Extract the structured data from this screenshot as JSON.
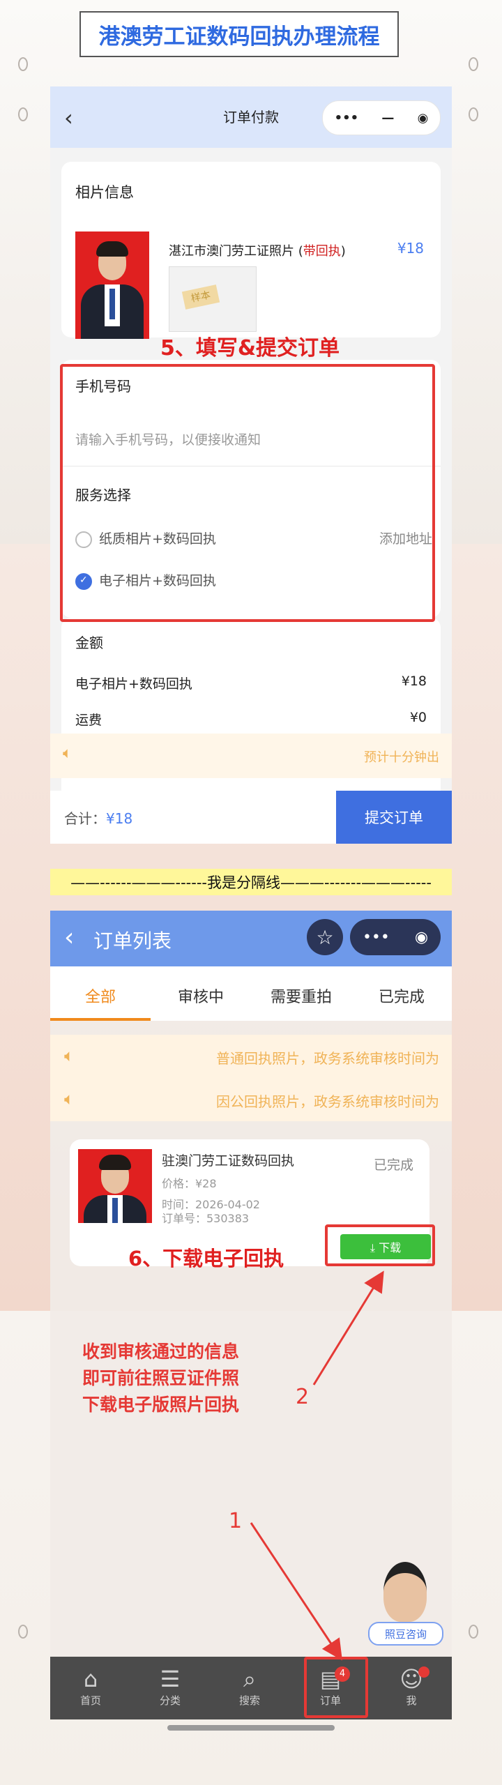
{
  "header": {
    "title": "港澳劳工证数码回执办理流程"
  },
  "screen1": {
    "nav": {
      "back_icon": "‹",
      "title": "订单付款",
      "more": "•••",
      "minimize": "—",
      "close": "◉"
    },
    "photo_section": {
      "heading": "相片信息",
      "product_name": "湛江市澳门劳工证照片 (",
      "product_tag": "带回执",
      "product_close": ")",
      "price": "¥18",
      "sample_stamp": "样本"
    },
    "step5": "5、填写&提交订单",
    "form": {
      "phone_label": "手机号码",
      "phone_placeholder": "请输入手机号码，以便接收通知",
      "service_label": "服务选择",
      "options": [
        {
          "label": "纸质相片+数码回执",
          "selected": false,
          "extra": "添加地址"
        },
        {
          "label": "电子相片+数码回执",
          "selected": true,
          "extra": ""
        }
      ]
    },
    "amount": {
      "heading": "金额",
      "rows": [
        {
          "label": "电子相片+数码回执",
          "value": "¥18"
        },
        {
          "label": "运费",
          "value": "¥0"
        }
      ]
    },
    "notice": {
      "icon": "speaker-icon",
      "text": "预计十分钟出"
    },
    "footer": {
      "total_label": "合计：",
      "total_amount": "¥18",
      "submit": "提交订单"
    }
  },
  "separator": "——------———------我是分隔线———-------———-----",
  "screen2": {
    "nav": {
      "back_icon": "‹",
      "title": "订单列表",
      "star": "☆",
      "more": "•••",
      "close": "◉"
    },
    "tabs": [
      "全部",
      "审核中",
      "需要重拍",
      "已完成"
    ],
    "active_tab": 0,
    "notices": [
      "普通回执照片，政务系统审核时间为",
      "因公回执照片，政务系统审核时间为"
    ],
    "order": {
      "name": "驻澳门劳工证数码回执",
      "status": "已完成",
      "price": "价格：¥28",
      "time": "时间：2026-04-02",
      "order_no": "订单号：530383",
      "download": "⤓ 下载"
    },
    "step6": "6、下载电子回执",
    "annotation": [
      "收到审核通过的信息",
      "即可前往照豆证件照",
      "下载电子版照片回执"
    ],
    "marker1": "1",
    "marker2": "2",
    "consult": "照豆咨询",
    "tabbar": [
      {
        "label": "首页",
        "icon": "⌂"
      },
      {
        "label": "分类",
        "icon": "☰"
      },
      {
        "label": "搜索",
        "icon": "⌕"
      },
      {
        "label": "订单",
        "icon": "▤",
        "badge": "4"
      },
      {
        "label": "我",
        "icon": "☺"
      }
    ]
  },
  "colors": {
    "accent_blue": "#3f6fe0",
    "annotation_red": "#e53935",
    "tab_orange": "#f08a1c",
    "download_green": "#3cbf3c"
  }
}
